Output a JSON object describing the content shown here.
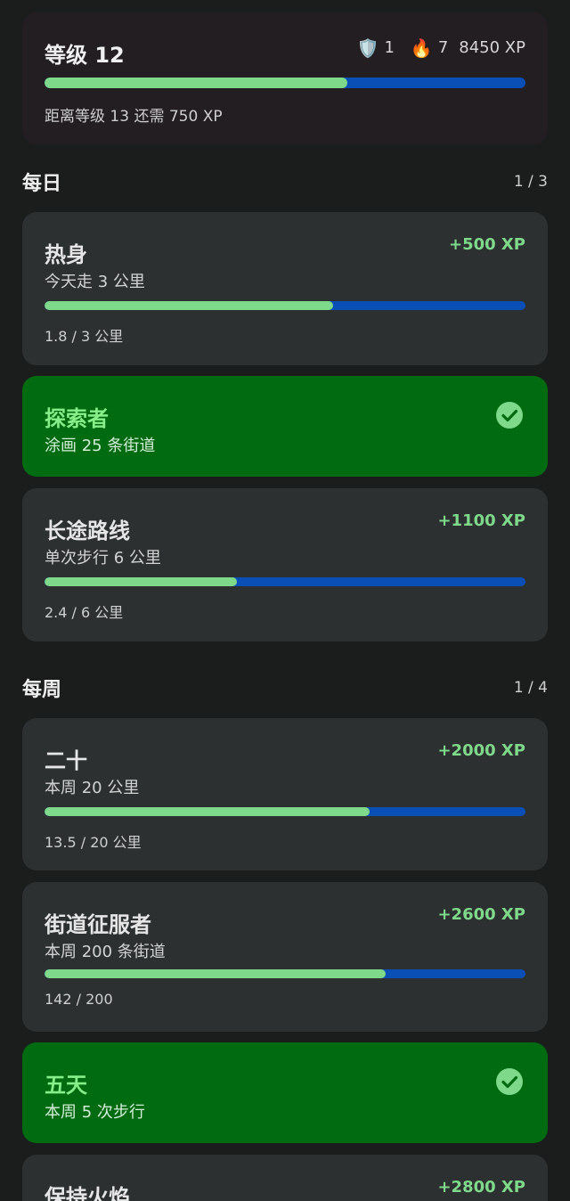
{
  "header": {
    "level_title": "等级 12",
    "shield_icon": "shield-icon",
    "shield_count": "1",
    "streak_icon": "fire-icon",
    "streak_count": "7",
    "xp_total": "8450 XP",
    "level_progress": 0.63,
    "remaining_text": "距离等级 13 还需 750 XP"
  },
  "colors": {
    "background": "#1b1c1c",
    "card": "#2d3031",
    "done_card": "#006b10",
    "progress_fill": "#7ed98a",
    "progress_track": "#0a4fb5",
    "reward": "#7ed98a"
  },
  "daily": {
    "title": "每日",
    "count": "1 / 3",
    "quests": [
      {
        "title": "热身",
        "desc": "今天走 3 公里",
        "reward": "+500 XP",
        "progress_text": "1.8 / 3 公里",
        "progress": 0.6,
        "completed": false
      },
      {
        "title": "探索者",
        "desc": "涂画 25 条街道",
        "completed": true
      },
      {
        "title": "长途路线",
        "desc": "单次步行 6 公里",
        "reward": "+1100 XP",
        "progress_text": "2.4 / 6 公里",
        "progress": 0.4,
        "completed": false
      }
    ]
  },
  "weekly": {
    "title": "每周",
    "count": "1 / 4",
    "quests": [
      {
        "title": "二十",
        "desc": "本周 20 公里",
        "reward": "+2000 XP",
        "progress_text": "13.5 / 20 公里",
        "progress": 0.675,
        "completed": false
      },
      {
        "title": "街道征服者",
        "desc": "本周 200 条街道",
        "reward": "+2600 XP",
        "progress_text": "142 / 200",
        "progress": 0.71,
        "completed": false
      },
      {
        "title": "五天",
        "desc": "本周 5 次步行",
        "completed": true
      },
      {
        "title": "保持火焰",
        "reward": "+2800 XP",
        "completed": false
      }
    ]
  }
}
